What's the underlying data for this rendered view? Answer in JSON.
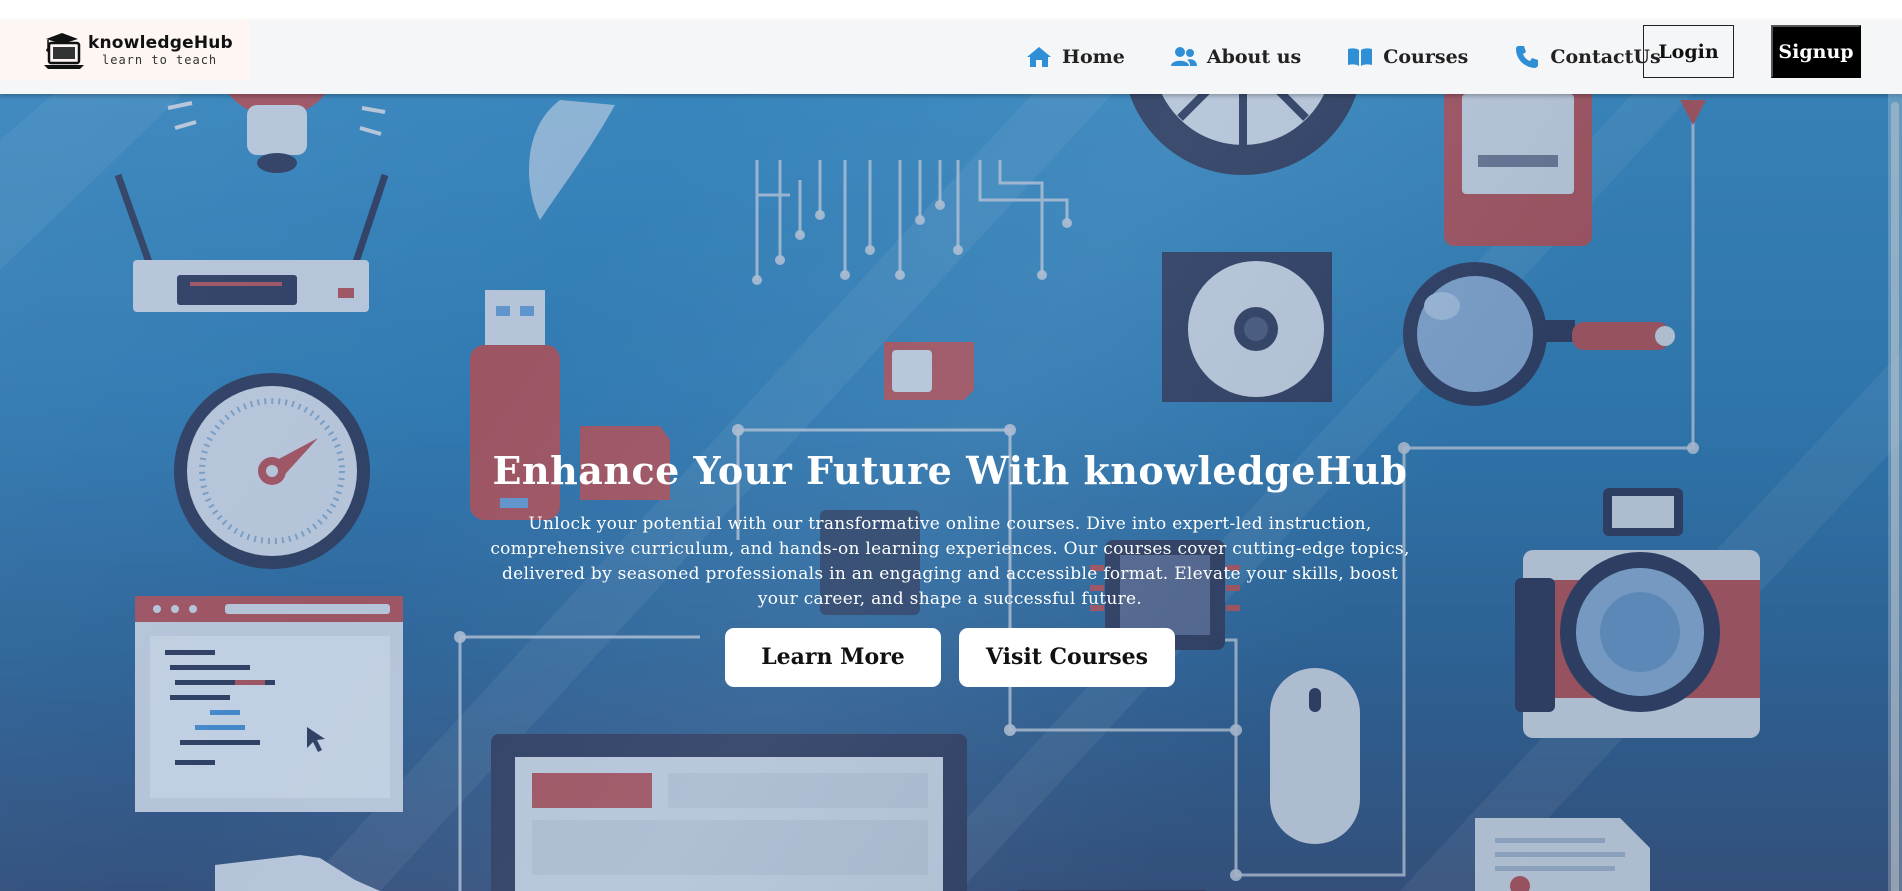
{
  "brand": {
    "name": "knowledgeHub",
    "tagline": "learn to teach"
  },
  "nav": {
    "items": [
      {
        "label": "Home",
        "icon": "home-icon"
      },
      {
        "label": "About us",
        "icon": "users-icon"
      },
      {
        "label": "Courses",
        "icon": "book-icon"
      },
      {
        "label": "ContactUs",
        "icon": "phone-icon"
      }
    ],
    "login_label": "Login",
    "signup_label": "Signup"
  },
  "hero": {
    "title": "Enhance Your Future With knowledgeHub",
    "description": "Unlock your potential with our transformative online courses. Dive into expert-led instruction, comprehensive curriculum, and hands-on learning experiences. Our courses cover cutting-edge topics, delivered by seasoned professionals in an engaging and accessible format. Elevate your skills, boost your career, and shape a successful future.",
    "learn_more_label": "Learn More",
    "visit_courses_label": "Visit Courses"
  },
  "colors": {
    "accent_blue": "#2f8fd6",
    "hero_blue": "#3a8bc2",
    "navbar_bg": "#f5f6f8",
    "signup_bg": "#000000"
  }
}
